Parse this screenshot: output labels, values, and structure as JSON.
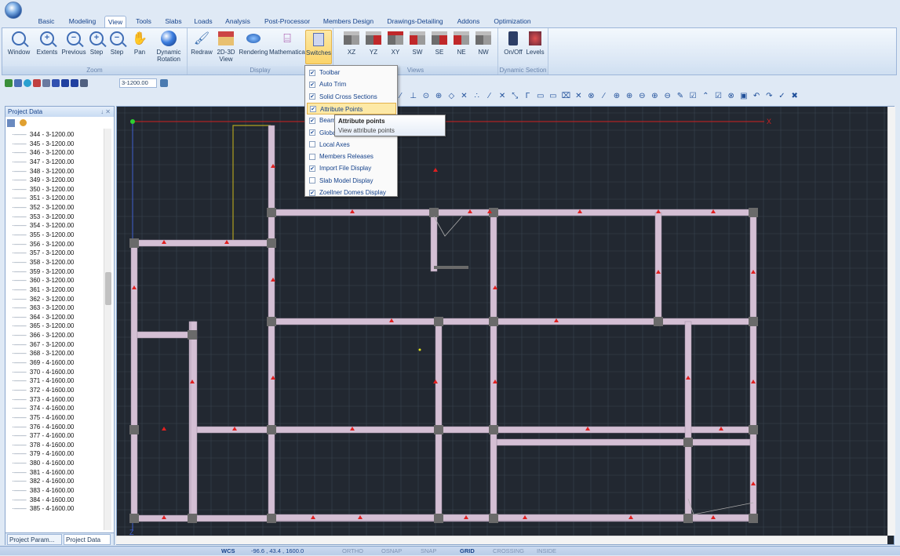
{
  "tabs": [
    "Basic",
    "Modeling",
    "View",
    "Tools",
    "Slabs",
    "Loads",
    "Analysis",
    "Post-Processor",
    "Members Design",
    "Drawings-Detailing",
    "Addons",
    "Optimization"
  ],
  "active_tab": "View",
  "ribbon": {
    "zoom": {
      "label": "Zoom",
      "buttons": [
        "Window",
        "Extents",
        "Previous",
        "Step",
        "Step"
      ],
      "step_sub": "+",
      "pan": "Pan",
      "dynamic_rotation": "Dynamic Rotation"
    },
    "display": {
      "label": "Display",
      "buttons": [
        "Redraw",
        "2D-3D View",
        "Rendering",
        "Mathematical",
        "Switches"
      ]
    },
    "views": {
      "label": "Views",
      "buttons": [
        "XZ",
        "YZ",
        "XY",
        "SW",
        "SE",
        "NE",
        "NW"
      ]
    },
    "dynamic_section": {
      "label": "Dynamic Section",
      "buttons": [
        "On/Off",
        "Levels"
      ]
    }
  },
  "qat": {
    "level_combo": "3-1200.00"
  },
  "project_panel": {
    "title": "Project Data",
    "pin": "↓ ✕",
    "items": [
      "344 - 3-1200.00",
      "345 - 3-1200.00",
      "346 - 3-1200.00",
      "347 - 3-1200.00",
      "348 - 3-1200.00",
      "349 - 3-1200.00",
      "350 - 3-1200.00",
      "351 - 3-1200.00",
      "352 - 3-1200.00",
      "353 - 3-1200.00",
      "354 - 3-1200.00",
      "355 - 3-1200.00",
      "356 - 3-1200.00",
      "357 - 3-1200.00",
      "358 - 3-1200.00",
      "359 - 3-1200.00",
      "360 - 3-1200.00",
      "361 - 3-1200.00",
      "362 - 3-1200.00",
      "363 - 3-1200.00",
      "364 - 3-1200.00",
      "365 - 3-1200.00",
      "366 - 3-1200.00",
      "367 - 3-1200.00",
      "368 - 3-1200.00",
      "369 - 4-1600.00",
      "370 - 4-1600.00",
      "371 - 4-1600.00",
      "372 - 4-1600.00",
      "373 - 4-1600.00",
      "374 - 4-1600.00",
      "375 - 4-1600.00",
      "376 - 4-1600.00",
      "377 - 4-1600.00",
      "378 - 4-1600.00",
      "379 - 4-1600.00",
      "380 - 4-1600.00",
      "381 - 4-1600.00",
      "382 - 4-1600.00",
      "383 - 4-1600.00",
      "384 - 4-1600.00",
      "385 - 4-1600.00"
    ],
    "tabs": [
      "Project Param...",
      "Project Data"
    ]
  },
  "switches_menu": [
    {
      "label": "Toolbar",
      "checked": true
    },
    {
      "label": "Auto Trim",
      "checked": true
    },
    {
      "label": "Solid Cross Sections",
      "checked": true
    },
    {
      "label": "Attribute Points",
      "checked": true
    },
    {
      "label": "Beam",
      "checked": true
    },
    {
      "label": "Globa",
      "checked": true
    },
    {
      "label": "Local Axes",
      "checked": false
    },
    {
      "label": "Members Releases",
      "checked": false
    },
    {
      "label": "Import File Display",
      "checked": true
    },
    {
      "label": "Slab Model Display",
      "checked": false
    },
    {
      "label": "Zoellner Domes Display",
      "checked": true
    }
  ],
  "tooltip": {
    "title": "Attribute points",
    "body": "View attribute points"
  },
  "canvas": {
    "axis_x": "X",
    "axis_z": "Z"
  },
  "status": {
    "wcs": "WCS",
    "coords": "-96.6 , 43.4 , 1600.0",
    "toggles": [
      {
        "label": "ORTHO",
        "on": false
      },
      {
        "label": "OSNAP",
        "on": false
      },
      {
        "label": "SNAP",
        "on": false
      },
      {
        "label": "GRID",
        "on": true
      },
      {
        "label": "CROSSING",
        "on": false
      },
      {
        "label": "INSIDE",
        "on": false
      }
    ]
  },
  "colors": {
    "beam": "#d4bfd4",
    "grid": "#3a4450",
    "bg": "#222831",
    "marker": "#e02020",
    "axis": "#d02020"
  }
}
